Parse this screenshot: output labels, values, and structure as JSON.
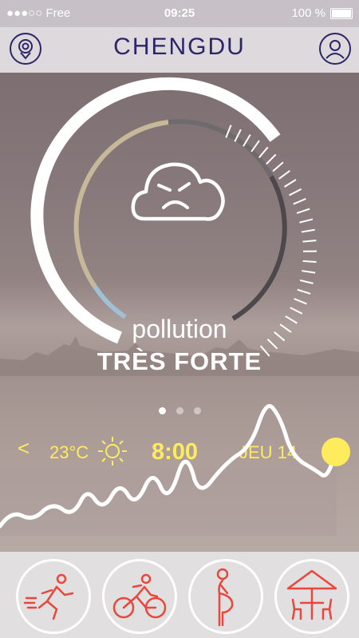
{
  "status_bar": {
    "carrier": "●●●○○ Free",
    "time": "09:25",
    "battery": "100 %"
  },
  "header": {
    "city": "CHENGDU",
    "left_icon": "location-pin-icon",
    "right_icon": "profile-icon"
  },
  "hero": {
    "pollution_label": "pollution",
    "pollution_level": "TRÈS FORTE",
    "mood_icon": "angry-cloud-icon",
    "page_indicator": {
      "count": 3,
      "active": 0
    }
  },
  "weather": {
    "prev_symbol": "<",
    "temperature": "23°C",
    "weather_icon": "sun-icon",
    "hour": "8:00",
    "day": "JEU 14",
    "next_symbol": ">"
  },
  "activities": [
    "running-icon",
    "cycling-icon",
    "pregnant-person-icon",
    "terrace-icon"
  ],
  "colors": {
    "accent_navy": "#2c2567",
    "forecast_yellow": "#ffec5c",
    "activity_red": "#e8473c"
  }
}
